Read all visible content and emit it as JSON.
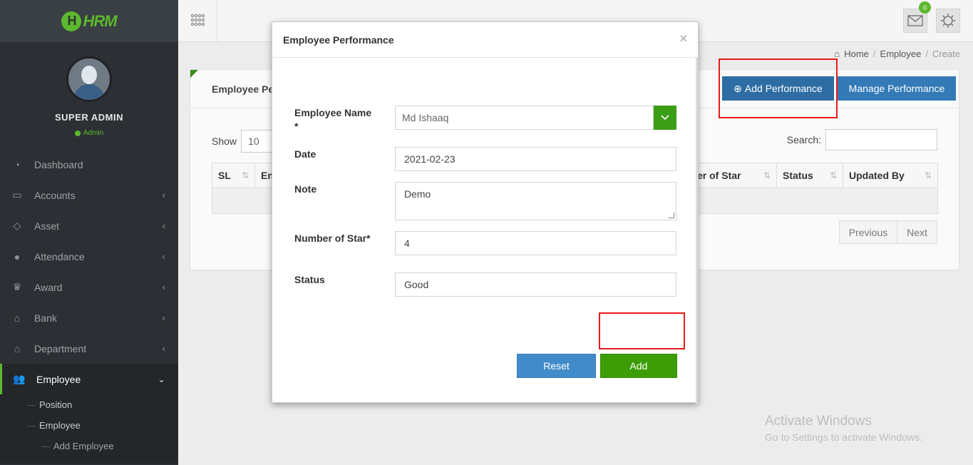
{
  "app": {
    "logo_text": "HRM",
    "logo_letter": "H"
  },
  "profile": {
    "name": "SUPER ADMIN",
    "role": "Admin"
  },
  "sidebar": {
    "items": [
      {
        "label": "Dashboard",
        "icon": "dashboard-icon",
        "glyph": "◔"
      },
      {
        "label": "Accounts",
        "icon": "briefcase-icon",
        "glyph": "▭",
        "arrow": "‹"
      },
      {
        "label": "Asset",
        "icon": "diamond-icon",
        "glyph": "◇",
        "arrow": "‹"
      },
      {
        "label": "Attendance",
        "icon": "user-icon",
        "glyph": "●",
        "arrow": "‹"
      },
      {
        "label": "Award",
        "icon": "trophy-icon",
        "glyph": "♛",
        "arrow": "‹"
      },
      {
        "label": "Bank",
        "icon": "bank-icon",
        "glyph": "⌂",
        "arrow": "‹"
      },
      {
        "label": "Department",
        "icon": "building-icon",
        "glyph": "⌂",
        "arrow": "‹"
      },
      {
        "label": "Employee",
        "icon": "users-icon",
        "glyph": "👥",
        "arrow": "⌄"
      }
    ],
    "sub_items": [
      "Position",
      "Employee",
      "Add Employee"
    ]
  },
  "topbar": {
    "badge_count": "0"
  },
  "breadcrumb": {
    "home": "Home",
    "section": "Employee",
    "current": "Create"
  },
  "panel": {
    "title": "Employee Per",
    "add_performance_label": "Add Performance",
    "manage_performance_label": "Manage Performance",
    "show_label": "Show",
    "show_value": "10",
    "search_label": "Search:",
    "columns": [
      "SL",
      "Em",
      "er of Star",
      "Status",
      "Updated By"
    ],
    "previous_label": "Previous",
    "next_label": "Next"
  },
  "modal": {
    "title": "Employee Performance",
    "close": "×",
    "fields": {
      "employee_name_label": "Employee Name *",
      "employee_name_value": "Md Ishaaq",
      "date_label": "Date",
      "date_value": "2021-02-23",
      "note_label": "Note",
      "note_value": "Demo",
      "stars_label": "Number of Star*",
      "stars_value": "4",
      "status_label": "Status",
      "status_value": "Good"
    },
    "reset_label": "Reset",
    "add_label": "Add"
  },
  "watermark": {
    "line1": "Activate Windows",
    "line2": "Go to Settings to activate Windows."
  },
  "colors": {
    "brand_green": "#5cb82e",
    "primary_blue": "#337ab7",
    "button_green": "#3c9d06",
    "highlight_red": "#e81a1a",
    "sidebar_bg": "#2c3034"
  }
}
